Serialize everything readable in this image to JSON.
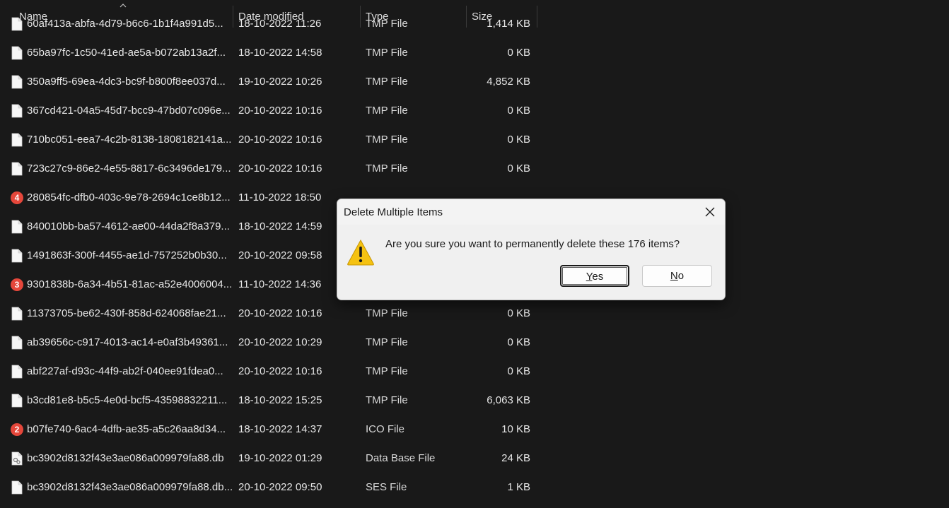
{
  "columns": {
    "name": "Name",
    "date": "Date modified",
    "type": "Type",
    "size": "Size"
  },
  "files": [
    {
      "name": "60af413a-abfa-4d79-b6c6-1b1f4a991d5...",
      "date": "18-10-2022 11:26",
      "type": "TMP File",
      "size": "1,414 KB",
      "icon": "file-icon"
    },
    {
      "name": "65ba97fc-1c50-41ed-ae5a-b072ab13a2f...",
      "date": "18-10-2022 14:58",
      "type": "TMP File",
      "size": "0 KB",
      "icon": "file-icon"
    },
    {
      "name": "350a9ff5-69ea-4dc3-bc9f-b800f8ee037d...",
      "date": "19-10-2022 10:26",
      "type": "TMP File",
      "size": "4,852 KB",
      "icon": "file-icon"
    },
    {
      "name": "367cd421-04a5-45d7-bcc9-47bd07c096e...",
      "date": "20-10-2022 10:16",
      "type": "TMP File",
      "size": "0 KB",
      "icon": "file-icon"
    },
    {
      "name": "710bc051-eea7-4c2b-8138-1808182141a...",
      "date": "20-10-2022 10:16",
      "type": "TMP File",
      "size": "0 KB",
      "icon": "file-icon"
    },
    {
      "name": "723c27c9-86e2-4e55-8817-6c3496de179...",
      "date": "20-10-2022 10:16",
      "type": "TMP File",
      "size": "0 KB",
      "icon": "file-icon"
    },
    {
      "name": "280854fc-dfb0-403c-9e78-2694c1ce8b12...",
      "date": "11-10-2022 18:50",
      "type": "",
      "size": "",
      "icon": "badge",
      "badge": "4"
    },
    {
      "name": "840010bb-ba57-4612-ae00-44da2f8a379...",
      "date": "18-10-2022 14:59",
      "type": "",
      "size": "",
      "icon": "file-icon"
    },
    {
      "name": "1491863f-300f-4455-ae1d-757252b0b30...",
      "date": "20-10-2022 09:58",
      "type": "",
      "size": "",
      "icon": "file-icon"
    },
    {
      "name": "9301838b-6a34-4b51-81ac-a52e4006004...",
      "date": "11-10-2022 14:36",
      "type": "",
      "size": "",
      "icon": "badge",
      "badge": "3"
    },
    {
      "name": "11373705-be62-430f-858d-624068fae21...",
      "date": "20-10-2022 10:16",
      "type": "TMP File",
      "size": "0 KB",
      "icon": "file-icon"
    },
    {
      "name": "ab39656c-c917-4013-ac14-e0af3b49361...",
      "date": "20-10-2022 10:29",
      "type": "TMP File",
      "size": "0 KB",
      "icon": "file-icon"
    },
    {
      "name": "abf227af-d93c-44f9-ab2f-040ee91fdea0...",
      "date": "20-10-2022 10:16",
      "type": "TMP File",
      "size": "0 KB",
      "icon": "file-icon"
    },
    {
      "name": "b3cd81e8-b5c5-4e0d-bcf5-43598832211...",
      "date": "18-10-2022 15:25",
      "type": "TMP File",
      "size": "6,063 KB",
      "icon": "file-icon"
    },
    {
      "name": "b07fe740-6ac4-4dfb-ae35-a5c26aa8d34...",
      "date": "18-10-2022 14:37",
      "type": "ICO File",
      "size": "10 KB",
      "icon": "badge",
      "badge": "2"
    },
    {
      "name": "bc3902d8132f43e3ae086a009979fa88.db",
      "date": "19-10-2022 01:29",
      "type": "Data Base File",
      "size": "24 KB",
      "icon": "db-file-icon"
    },
    {
      "name": "bc3902d8132f43e3ae086a009979fa88.db...",
      "date": "20-10-2022 09:50",
      "type": "SES File",
      "size": "1 KB",
      "icon": "file-icon"
    }
  ],
  "dialog": {
    "title": "Delete Multiple Items",
    "message": "Are you sure you want to permanently delete these 176 items?",
    "yes_first": "Y",
    "yes_rest": "es",
    "no_first": "N",
    "no_rest": "o",
    "icon": "warning-icon",
    "close_icon": "close-icon"
  }
}
